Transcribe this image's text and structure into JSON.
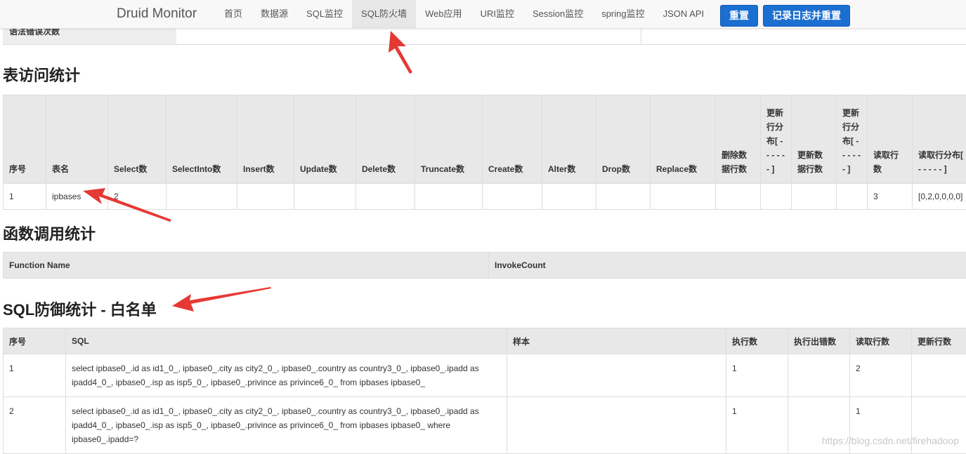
{
  "navbar": {
    "brand": "Druid Monitor",
    "items": [
      "首页",
      "数据源",
      "SQL监控",
      "SQL防火墙",
      "Web应用",
      "URI监控",
      "Session监控",
      "spring监控",
      "JSON API"
    ],
    "active_index": 3,
    "reset_label": "重置",
    "log_reset_label": "记录日志并重置"
  },
  "top_row": {
    "label": "语法错误次数"
  },
  "table_access": {
    "title": "表访问统计",
    "headers": [
      "序号",
      "表名",
      "Select数",
      "SelectInto数",
      "Insert数",
      "Update数",
      "Delete数",
      "Truncate数",
      "Create数",
      "Alter数",
      "Drop数",
      "Replace数",
      "删除数据行数",
      "更新行分布[ - - - - - - ]",
      "更新数据行数",
      "更新行分布[ - - - - - - ]",
      "读取行数",
      "读取行分布[ - - - - - - ]"
    ],
    "rows": [
      [
        "1",
        "ipbases",
        "2",
        "",
        "",
        "",
        "",
        "",
        "",
        "",
        "",
        "",
        "",
        "",
        "",
        "",
        "3",
        "[0,2,0,0,0,0]"
      ]
    ]
  },
  "table_func": {
    "title": "函数调用统计",
    "headers": [
      "Function Name",
      "InvokeCount"
    ]
  },
  "table_waf": {
    "title": "SQL防御统计 - 白名单",
    "headers": [
      "序号",
      "SQL",
      "样本",
      "执行数",
      "执行出错数",
      "读取行数",
      "更新行数"
    ],
    "rows": [
      [
        "1",
        "select ipbase0_.id as id1_0_, ipbase0_.city as city2_0_, ipbase0_.country as country3_0_, ipbase0_.ipadd as ipadd4_0_, ipbase0_.isp as isp5_0_, ipbase0_.privince as privince6_0_ from ipbases ipbase0_",
        "",
        "1",
        "",
        "2",
        ""
      ],
      [
        "2",
        "select ipbase0_.id as id1_0_, ipbase0_.city as city2_0_, ipbase0_.country as country3_0_, ipbase0_.ipadd as ipadd4_0_, ipbase0_.isp as isp5_0_, ipbase0_.privince as privince6_0_ from ipbases ipbase0_ where ipbase0_.ipadd=?",
        "",
        "1",
        "",
        "1",
        ""
      ]
    ]
  },
  "watermark": "https://blog.csdn.net/firehadoop",
  "colors": {
    "primary_button": "#1a6fd1",
    "arrow": "#e53935"
  }
}
